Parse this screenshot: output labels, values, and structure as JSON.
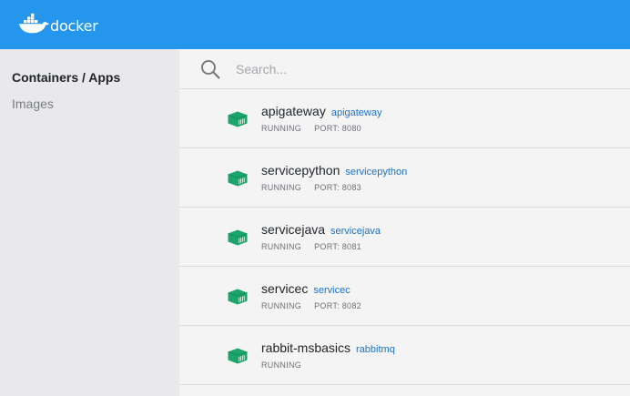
{
  "header": {
    "brand": "docker",
    "brand_color": "#2496ed"
  },
  "sidebar": {
    "items": [
      {
        "label": "Containers / Apps",
        "active": true
      },
      {
        "label": "Images",
        "active": false
      }
    ]
  },
  "search": {
    "placeholder": "Search..."
  },
  "containers": [
    {
      "name": "apigateway",
      "image": "apigateway",
      "status": "RUNNING",
      "port": "PORT: 8080"
    },
    {
      "name": "servicepython",
      "image": "servicepython",
      "status": "RUNNING",
      "port": "PORT: 8083"
    },
    {
      "name": "servicejava",
      "image": "servicejava",
      "status": "RUNNING",
      "port": "PORT: 8081"
    },
    {
      "name": "servicec",
      "image": "servicec",
      "status": "RUNNING",
      "port": "PORT: 8082"
    },
    {
      "name": "rabbit-msbasics",
      "image": "rabbitmq",
      "status": "RUNNING",
      "port": ""
    }
  ],
  "colors": {
    "running_icon": "#1ba56b",
    "image_link": "#1a73c8"
  },
  "icons": {
    "logo": "docker-whale-icon",
    "search": "search-icon",
    "container": "container-icon"
  }
}
